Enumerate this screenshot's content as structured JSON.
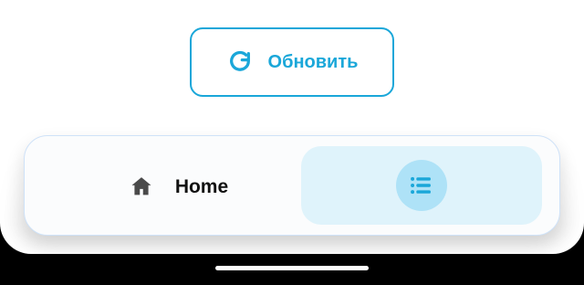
{
  "header": {
    "refresh_button_label": "Обновить",
    "refresh_icon": "refresh-icon"
  },
  "bottom_nav": {
    "items": [
      {
        "label": "Home",
        "icon": "home-icon",
        "selected": false
      },
      {
        "label": "",
        "icon": "list-icon",
        "selected": true
      }
    ]
  },
  "colors": {
    "accent": "#1aa7d9",
    "selected_background": "#dff3fb",
    "selected_icon_background": "#aee2f7",
    "home_icon": "#4a4a4a",
    "text_primary": "#111111",
    "surface": "#ffffff",
    "system_bar": "#000000"
  }
}
